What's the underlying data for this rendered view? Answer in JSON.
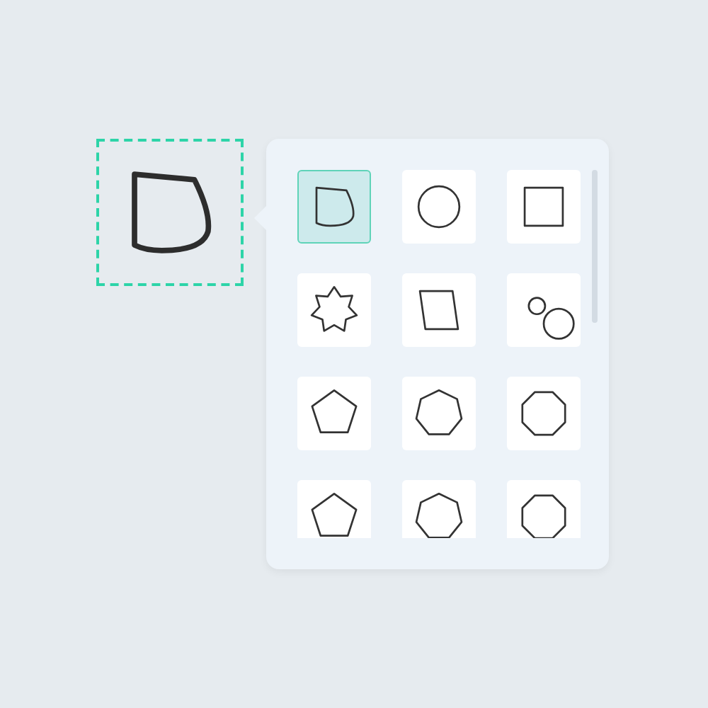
{
  "canvas": {
    "kind": "blob",
    "selected": true
  },
  "shapes": [
    {
      "kind": "blob",
      "selected": true
    },
    {
      "kind": "circle",
      "selected": false
    },
    {
      "kind": "square",
      "selected": false
    },
    {
      "kind": "star",
      "selected": false
    },
    {
      "kind": "parallelogram",
      "selected": false
    },
    {
      "kind": "circles",
      "selected": false
    },
    {
      "kind": "pentagon",
      "selected": false
    },
    {
      "kind": "heptagon",
      "selected": false
    },
    {
      "kind": "octagon",
      "selected": false
    },
    {
      "kind": "pentagon",
      "selected": false
    },
    {
      "kind": "heptagon",
      "selected": false
    },
    {
      "kind": "octagon",
      "selected": false
    }
  ]
}
